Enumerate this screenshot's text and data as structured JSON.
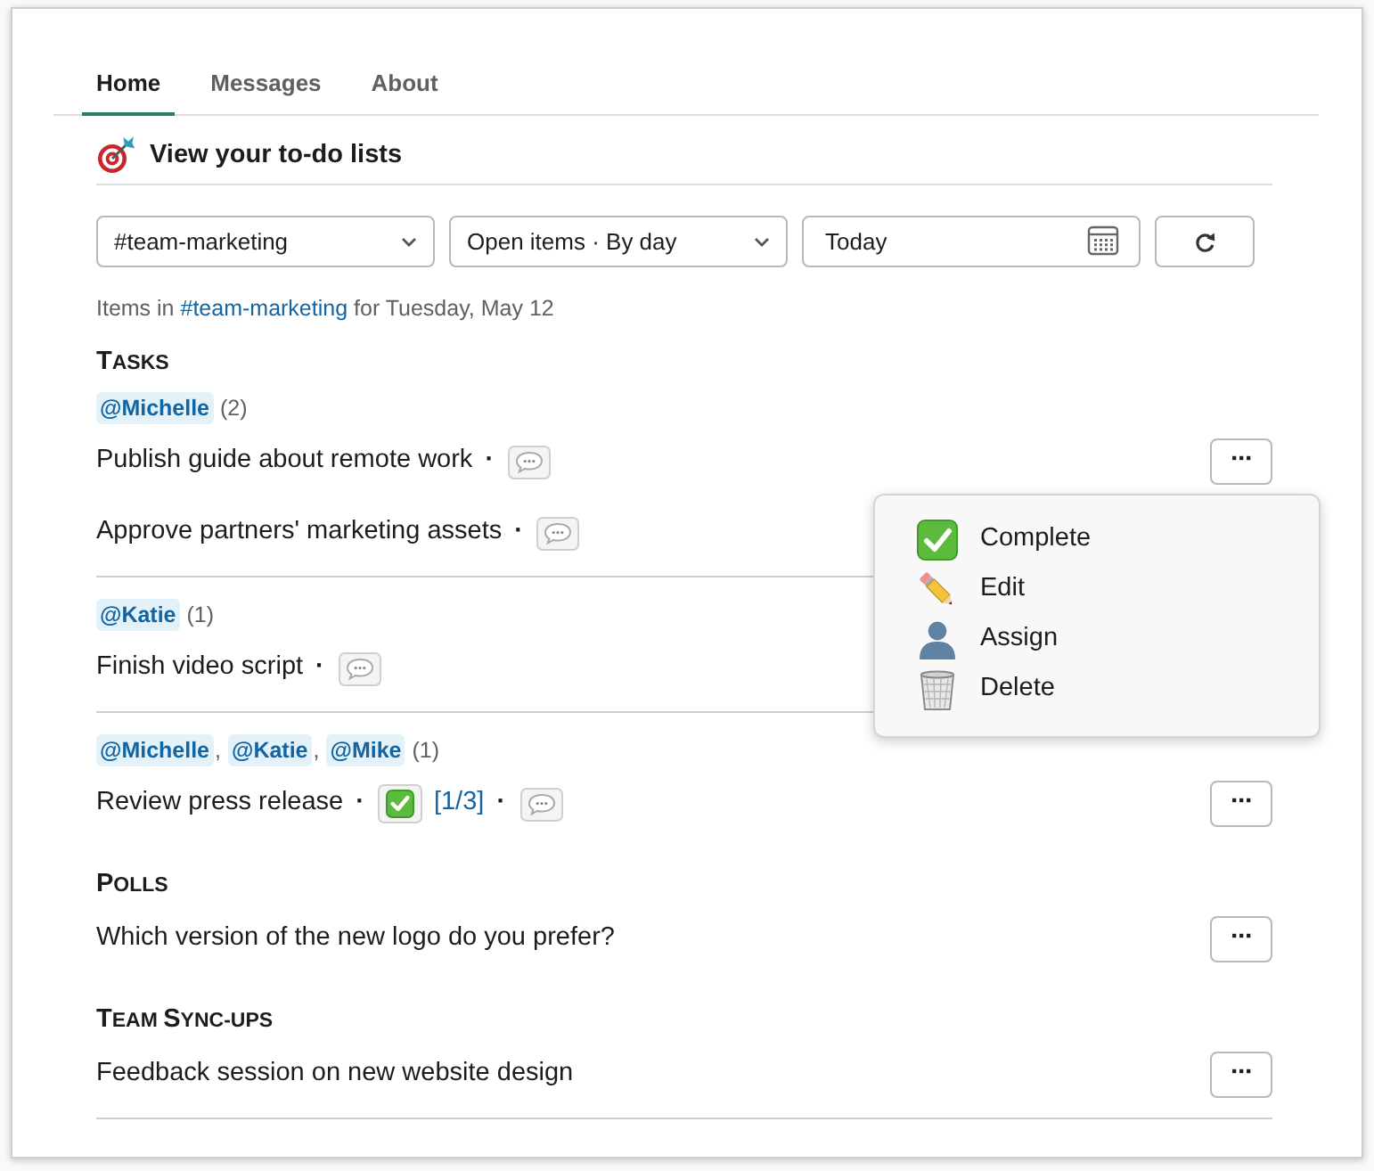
{
  "tabs": [
    {
      "label": "Home",
      "selected": true
    },
    {
      "label": "Messages",
      "selected": false
    },
    {
      "label": "About",
      "selected": false
    }
  ],
  "header": {
    "title": "View your to-do lists"
  },
  "filters": {
    "channel": "#team-marketing",
    "view": "Open items · By day",
    "date": "Today"
  },
  "caption": {
    "prefix": "Items in",
    "channel": "#team-marketing",
    "suffix": "for Tuesday, May 12"
  },
  "sections": [
    {
      "title": "TASKS",
      "groups": [
        {
          "assignees": [
            {
              "kind": "mention",
              "text": "@Michelle"
            },
            {
              "kind": "count",
              "text": "(2)"
            }
          ],
          "items": [
            {
              "parts": [
                {
                  "kind": "text",
                  "text": "Publish guide about remote work"
                },
                {
                  "kind": "dot",
                  "text": "·"
                },
                {
                  "kind": "comments"
                }
              ],
              "more_label": "···"
            },
            {
              "parts": [
                {
                  "kind": "text",
                  "text": "Approve partners' marketing assets"
                },
                {
                  "kind": "dot",
                  "text": "·"
                },
                {
                  "kind": "comments"
                }
              ]
            }
          ]
        },
        {
          "assignees": [
            {
              "kind": "mention",
              "text": "@Katie"
            },
            {
              "kind": "count",
              "text": "(1)"
            }
          ],
          "items": [
            {
              "parts": [
                {
                  "kind": "text",
                  "text": "Finish video script"
                },
                {
                  "kind": "dot",
                  "text": "·"
                },
                {
                  "kind": "comments"
                }
              ]
            }
          ]
        },
        {
          "assignees": [
            {
              "kind": "mention",
              "text": "@Michelle"
            },
            {
              "kind": "comma",
              "text": ","
            },
            {
              "kind": "mention",
              "text": "@Katie"
            },
            {
              "kind": "comma",
              "text": ","
            },
            {
              "kind": "mention",
              "text": "@Mike"
            },
            {
              "kind": "count",
              "text": "(1)"
            }
          ],
          "items": [
            {
              "parts": [
                {
                  "kind": "text",
                  "text": "Review press release"
                },
                {
                  "kind": "dot",
                  "text": "·"
                },
                {
                  "kind": "check"
                },
                {
                  "kind": "link",
                  "text": "[1/3]"
                },
                {
                  "kind": "dot",
                  "text": "·"
                },
                {
                  "kind": "comments"
                }
              ],
              "more_label": "···"
            }
          ]
        }
      ]
    },
    {
      "title": "POLLS",
      "groups": [
        {
          "items": [
            {
              "parts": [
                {
                  "kind": "text",
                  "text": "Which version of the new logo do you prefer?"
                }
              ],
              "more_label": "···"
            }
          ]
        }
      ]
    },
    {
      "title": "TEAM SYNC-UPS",
      "groups": [
        {
          "items": [
            {
              "parts": [
                {
                  "kind": "text",
                  "text": "Feedback session on new website design"
                }
              ],
              "more_label": "···"
            }
          ]
        }
      ]
    }
  ],
  "menu": {
    "items": [
      {
        "kind": "complete",
        "label": "Complete"
      },
      {
        "kind": "edit",
        "label": "Edit"
      },
      {
        "kind": "assign",
        "label": "Assign"
      },
      {
        "kind": "delete",
        "label": "Delete"
      }
    ]
  }
}
